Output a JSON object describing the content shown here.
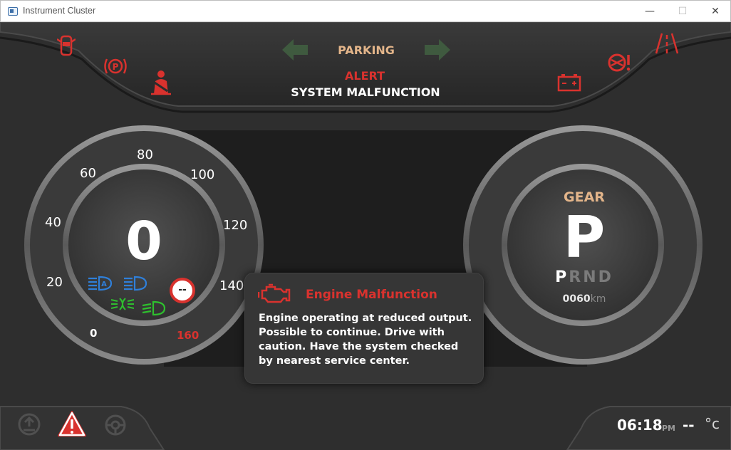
{
  "window": {
    "title": "Instrument Cluster",
    "minimize_glyph": "—",
    "maximize_glyph": "☐",
    "close_glyph": "✕"
  },
  "top_panel": {
    "turn_signal": "PARKING",
    "alert_title": "ALERT",
    "alert_message": "SYSTEM MALFUNCTION",
    "left_warnings": [
      "door-open-icon",
      "parking-brake-icon",
      "seatbelt-icon"
    ],
    "right_warnings": [
      "battery-icon",
      "steering-fault-icon",
      "lane-departure-icon"
    ],
    "colors": {
      "warning": "#d9322e",
      "signal_inactive": "#3f5a3f",
      "accent": "#e3b58a"
    }
  },
  "speedometer": {
    "value": "0",
    "scale_labels": [
      "20",
      "40",
      "60",
      "80",
      "100",
      "120",
      "140"
    ],
    "min_label": "0",
    "max_label": "160",
    "speed_limit": "--",
    "indicators": [
      "auto-high-beam-icon",
      "high-beam-icon",
      "fog-light-icon",
      "low-beam-icon"
    ],
    "colors": {
      "indicator_blue": "#2f7fd9",
      "indicator_green": "#2ec02e"
    }
  },
  "gear": {
    "label": "GEAR",
    "current": "P",
    "sequence": [
      "P",
      "R",
      "N",
      "D"
    ],
    "active": "P",
    "odometer": "0060",
    "odometer_unit": "km"
  },
  "popup": {
    "title": "Engine Malfunction",
    "icon": "check-engine-icon",
    "body": "Engine operating at reduced output. Possible to continue. Drive with caution. Have the system checked by nearest service center."
  },
  "bottom_bar": {
    "left_icons": [
      "tire-pressure-icon",
      "hazard-triangle-icon",
      "steering-assist-icon"
    ],
    "time": "06:18",
    "ampm": "PM",
    "temperature": "--",
    "temperature_unit": "°c"
  }
}
